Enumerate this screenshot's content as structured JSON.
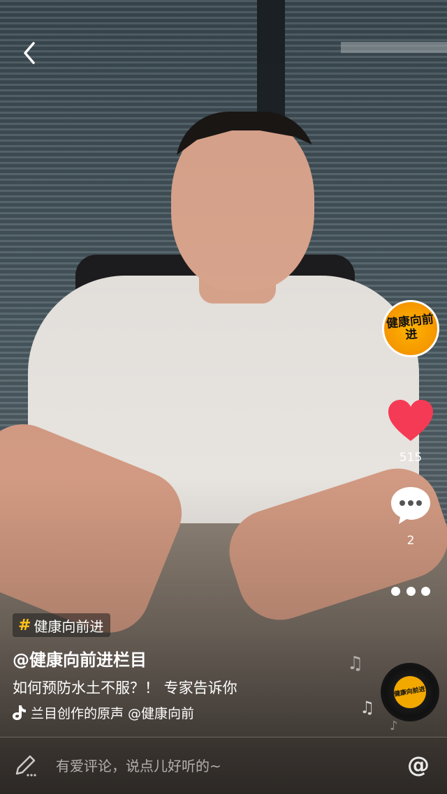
{
  "nav": {
    "back_icon": "chevron-left-icon"
  },
  "creator": {
    "avatar_text": "健康向前进"
  },
  "actions": {
    "like_icon": "heart-icon",
    "like_color": "#f53a55",
    "like_count": "515",
    "comment_icon": "speech-bubble-icon",
    "comment_count": "2",
    "more_icon": "more-dots-icon"
  },
  "post": {
    "hashtag_symbol": "#",
    "hashtag_color": "#ffc21a",
    "hashtag": "健康向前进",
    "author": "@健康向前进栏目",
    "caption": "如何预防水土不服？！ 专家告诉你",
    "music_text": "兰目创作的原声    @健康向前"
  },
  "music_disc": {
    "label": "健康向前进"
  },
  "comment_bar": {
    "pen_icon": "pen-icon",
    "placeholder": "有爱评论，说点儿好听的~",
    "at_symbol": "@"
  }
}
